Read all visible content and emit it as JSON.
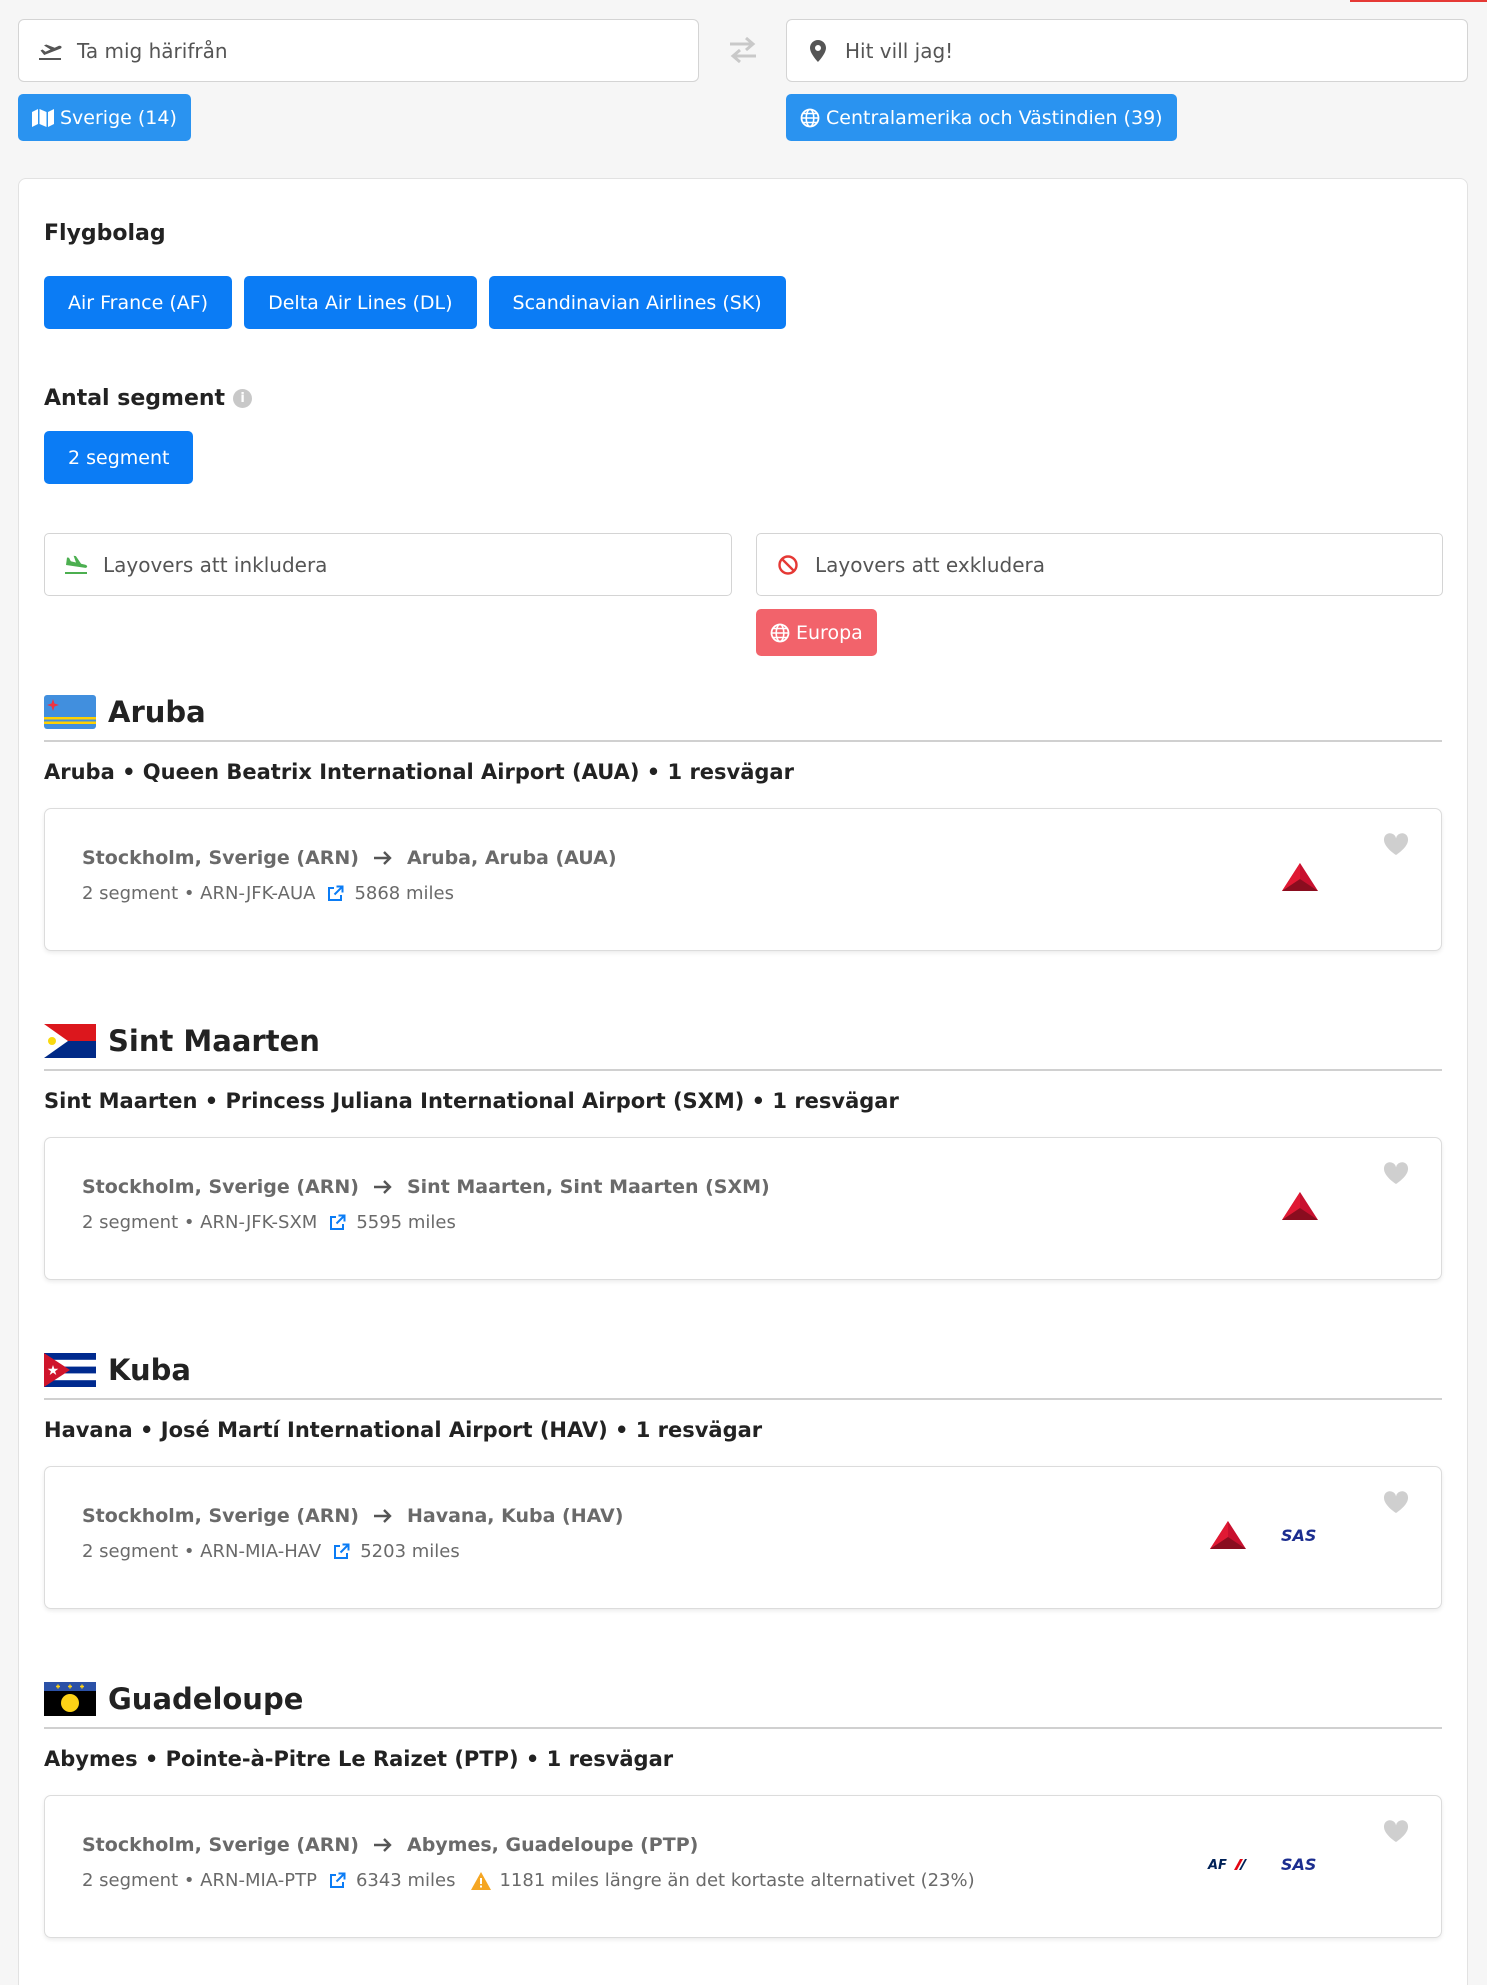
{
  "search": {
    "from_placeholder": "Ta mig härifrån",
    "to_placeholder": "Hit vill jag!",
    "from_chip": "Sverige (14)",
    "to_chip": "Centralamerika och Västindien (39)"
  },
  "filters": {
    "airlines_title": "Flygbolag",
    "airlines": [
      "Air France (AF)",
      "Delta Air Lines (DL)",
      "Scandinavian Airlines (SK)"
    ],
    "segments_title": "Antal segment",
    "segments": [
      "2 segment"
    ],
    "layover_include_placeholder": "Layovers att inkludera",
    "layover_exclude_placeholder": "Layovers att exkludera",
    "excluded_chip": "Europa"
  },
  "colors": {
    "accent": "#0b7cf5",
    "chip_blue": "#2a93f0",
    "exclude_red": "#f2636b",
    "delta_red": "#c8102e",
    "sas_blue": "#1b2d8f",
    "warning": "#f5a623"
  },
  "destinations": [
    {
      "country": "Aruba",
      "flag": "aruba-flag",
      "airport_line": "Aruba • Queen Beatrix International Airport (AUA) • 1 resvägar",
      "route": {
        "from": "Stockholm, Sverige (ARN)",
        "to": "Aruba, Aruba (AUA)",
        "details": "2 segment • ARN-JFK-AUA",
        "miles": "5868 miles",
        "warning": "",
        "airlines": [
          "delta-logo"
        ]
      }
    },
    {
      "country": "Sint Maarten",
      "flag": "sint-maarten-flag",
      "airport_line": "Sint Maarten • Princess Juliana International Airport (SXM) • 1 resvägar",
      "route": {
        "from": "Stockholm, Sverige (ARN)",
        "to": "Sint Maarten, Sint Maarten (SXM)",
        "details": "2 segment • ARN-JFK-SXM",
        "miles": "5595 miles",
        "warning": "",
        "airlines": [
          "delta-logo"
        ]
      }
    },
    {
      "country": "Kuba",
      "flag": "cuba-flag",
      "airport_line": "Havana • José Martí International Airport (HAV) • 1 resvägar",
      "route": {
        "from": "Stockholm, Sverige (ARN)",
        "to": "Havana, Kuba (HAV)",
        "details": "2 segment • ARN-MIA-HAV",
        "miles": "5203 miles",
        "warning": "",
        "airlines": [
          "delta-logo",
          "sas-logo"
        ]
      }
    },
    {
      "country": "Guadeloupe",
      "flag": "guadeloupe-flag",
      "airport_line": "Abymes • Pointe-à-Pitre Le Raizet (PTP) • 1 resvägar",
      "route": {
        "from": "Stockholm, Sverige (ARN)",
        "to": "Abymes, Guadeloupe (PTP)",
        "details": "2 segment • ARN-MIA-PTP",
        "miles": "6343 miles",
        "warning": "1181 miles längre än det kortaste alternativet (23%)",
        "airlines": [
          "air-france-logo",
          "sas-logo"
        ]
      }
    }
  ]
}
